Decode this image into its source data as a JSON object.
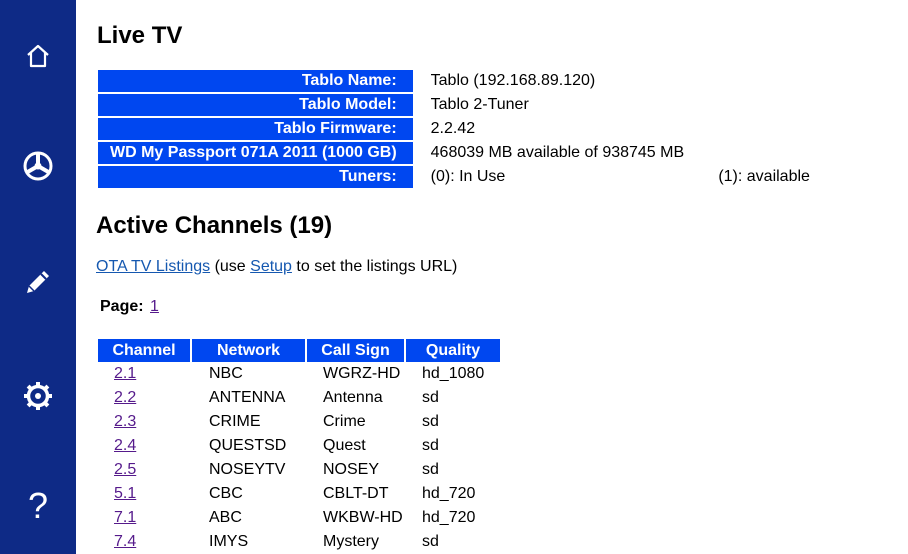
{
  "sidebar": {
    "items": [
      {
        "icon": "home-icon",
        "glyph": "⌂"
      },
      {
        "icon": "steering-wheel-icon"
      },
      {
        "icon": "pencil-icon"
      },
      {
        "icon": "gear-icon"
      },
      {
        "icon": "help-icon",
        "glyph": "?"
      }
    ],
    "color": "#0e2a86"
  },
  "page": {
    "title": "Live TV",
    "active_title": "Active Channels (19)"
  },
  "info": {
    "rows": [
      {
        "label": "Tablo Name:",
        "value": "Tablo (192.168.89.120)"
      },
      {
        "label": "Tablo Model:",
        "value": "Tablo 2-Tuner"
      },
      {
        "label": "Tablo Firmware:",
        "value": "2.2.42"
      },
      {
        "label": "WD My Passport 071A 2011 (1000 GB)",
        "value": "468039 MB available of 938745 MB"
      },
      {
        "label": "Tuners:",
        "value": "(0): In Use",
        "value2": "(1): available"
      }
    ],
    "header_color": "#0047f0"
  },
  "listings": {
    "link_text": "OTA TV Listings",
    "text_before_setup": " (use ",
    "setup_link": "Setup",
    "text_after_setup": " to set the listings URL)"
  },
  "paging": {
    "label": "Page:",
    "page": "1"
  },
  "channels": {
    "headers": [
      "Channel",
      "Network",
      "Call Sign",
      "Quality"
    ],
    "rows": [
      [
        "2.1",
        "NBC",
        "WGRZ-HD",
        "hd_1080"
      ],
      [
        "2.2",
        "ANTENNA",
        "Antenna",
        "sd"
      ],
      [
        "2.3",
        "CRIME",
        "Crime",
        "sd"
      ],
      [
        "2.4",
        "QUESTSD",
        "Quest",
        "sd"
      ],
      [
        "2.5",
        "NOSEYTV",
        "NOSEY",
        "sd"
      ],
      [
        "5.1",
        "CBC",
        "CBLT-DT",
        "hd_720"
      ],
      [
        "7.1",
        "ABC",
        "WKBW-HD",
        "hd_720"
      ],
      [
        "7.4",
        "IMYS",
        "Mystery",
        "sd"
      ]
    ]
  }
}
